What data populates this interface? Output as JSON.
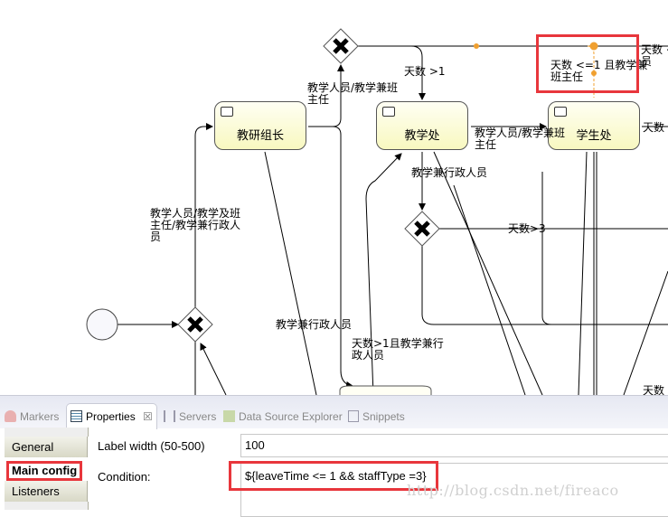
{
  "diagram": {
    "tasks": [
      {
        "label": "教研组长"
      },
      {
        "label": "教学处"
      },
      {
        "label": "学生处"
      }
    ],
    "flow_labels": {
      "days_gt1": "天数 >1",
      "teacher_headteacher_1": "教学人员/教学兼班\n主任",
      "highlighted_condition": "天数 <=1 且教学兼\n班主任",
      "right_top_clipped": "天数 <\n员",
      "teacher_headteacher_2": "教学人员/教学兼班\n主任",
      "right_mid_clipped": "天数 <",
      "teacher_admin_1": "教学兼行政人员",
      "days_gt3": "天数>3",
      "left_condition": "教学人员/教学及班\n主任/教学兼行政人\n员",
      "teacher_admin_2": "教学兼行政人员",
      "days_gt1_admin": "天数>1且教学兼行\n政人员",
      "bottom_right_clipped": "天数"
    },
    "highlight_color": "#f0a030",
    "annotation_color": "#e8363c"
  },
  "panel": {
    "tabs": [
      {
        "label": "Markers",
        "icon": "markers-icon"
      },
      {
        "label": "Properties",
        "icon": "properties-icon",
        "active": true
      },
      {
        "label": "Servers",
        "icon": "servers-icon"
      },
      {
        "label": "Data Source Explorer",
        "icon": "data-source-icon"
      },
      {
        "label": "Snippets",
        "icon": "snippets-icon"
      }
    ],
    "close_glyph": "☒",
    "sections": [
      {
        "label": "General"
      },
      {
        "label": "Main config",
        "selected": true
      },
      {
        "label": "Listeners"
      }
    ],
    "fields": {
      "label_width": {
        "label": "Label width (50-500)",
        "value": "100"
      },
      "condition": {
        "label": "Condition:",
        "value": "${leaveTime <= 1 && staffType =3}"
      }
    },
    "watermark": "http://blog.csdn.net/fireaco"
  }
}
